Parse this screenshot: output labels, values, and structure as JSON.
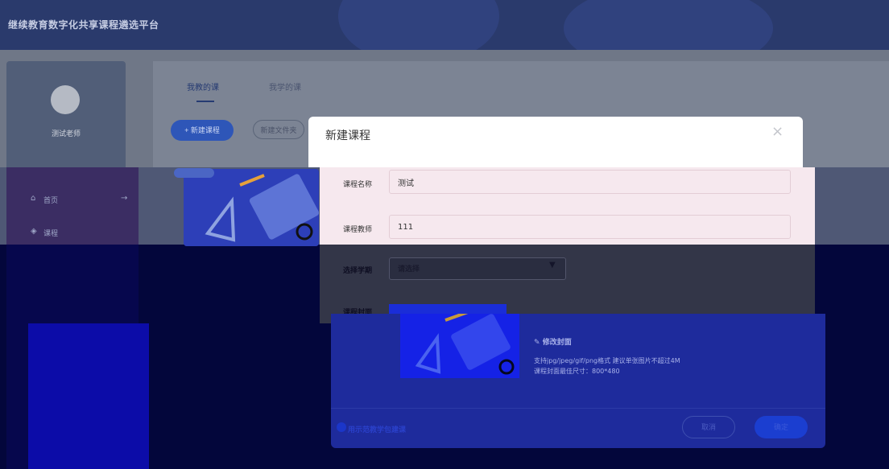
{
  "header": {
    "title": "继续教育数字化共享课程遴选平台"
  },
  "profile": {
    "name": "测试老师"
  },
  "tabs": [
    {
      "label": "我教的课",
      "active": true
    },
    {
      "label": "我学的课",
      "active": false
    }
  ],
  "toolbar": {
    "new_course_label": "+ 新建课程",
    "new_folder_label": "新建文件夹"
  },
  "sidebar": {
    "items": [
      {
        "label": "首页",
        "icon": "home-icon"
      },
      {
        "label": "课程",
        "icon": "course-icon"
      },
      {
        "label": "",
        "icon": ""
      },
      {
        "label": "",
        "icon": ""
      }
    ]
  },
  "modal": {
    "title": "新建课程",
    "close_icon": "×",
    "fields": {
      "course_name_label": "课程名称",
      "course_name_value": "测试",
      "teacher_label": "课程教师",
      "teacher_value": "111",
      "subject_label": "选择学期",
      "subject_placeholder": "请选择",
      "cover_label": "课程封面"
    },
    "cover": {
      "edit_label": "修改封面",
      "hint_format": "支持jpg/jpeg/gif/png格式 建议单张图片不超过4M",
      "hint_size": "课程封面最佳尺寸：800*480"
    },
    "footer": {
      "demo_link": "用示范教学包建课",
      "cancel_label": "取消",
      "ok_label": "确定"
    }
  },
  "colors": {
    "header": "#2a3a6c",
    "accent": "#2e56b8",
    "modal_pink": "#f6e8ee",
    "overlay_navy": "#03063b"
  }
}
